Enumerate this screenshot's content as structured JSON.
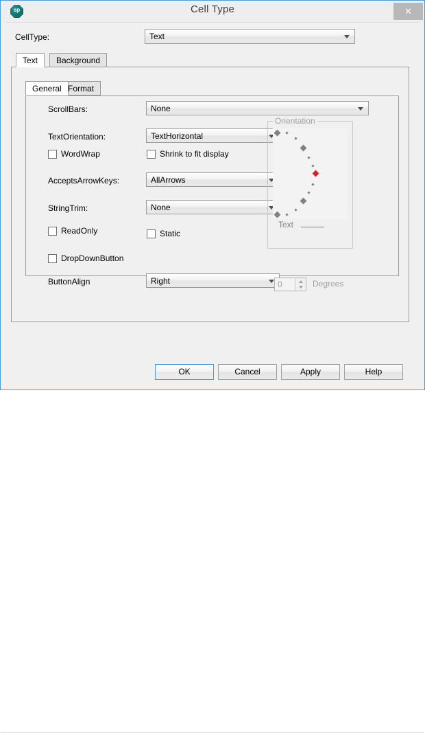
{
  "window": {
    "title": "Cell Type",
    "app_icon": "spreadsheet-octagon-icon",
    "app_icon_text": "sp",
    "close_label": "✕"
  },
  "celltype": {
    "label": "CellType:",
    "value": "Text"
  },
  "outer_tabs": [
    {
      "label": "Text",
      "active": true
    },
    {
      "label": "Background",
      "active": false
    }
  ],
  "inner_tabs": [
    {
      "label": "General",
      "active": true
    },
    {
      "label": "Format",
      "active": false
    }
  ],
  "form": {
    "scrollbars": {
      "label": "ScrollBars:",
      "value": "None"
    },
    "text_orientation": {
      "label": "TextOrientation:",
      "value": "TextHorizontal"
    },
    "word_wrap": {
      "label": "WordWrap",
      "checked": false
    },
    "shrink_to_fit": {
      "label": "Shrink to fit display",
      "checked": false
    },
    "accepts_arrow_keys": {
      "label": "AcceptsArrowKeys:",
      "value": "AllArrows"
    },
    "string_trim": {
      "label": "StringTrim:",
      "value": "None"
    },
    "read_only": {
      "label": "ReadOnly",
      "checked": false
    },
    "static": {
      "label": "Static",
      "checked": false
    },
    "dropdown_button": {
      "label": "DropDownButton",
      "checked": false
    },
    "button_align": {
      "label": "ButtonAlign",
      "value": "Right"
    }
  },
  "orientation": {
    "legend": "Orientation",
    "sample_text": "Text",
    "degrees_value": "0",
    "degrees_label": "Degrees",
    "enabled": false,
    "selected_color": "#d82020",
    "dot_color": "#808080"
  },
  "footer": {
    "ok": "OK",
    "cancel": "Cancel",
    "apply": "Apply",
    "help": "Help"
  },
  "colors": {
    "window_border": "#4a9bd8",
    "dialog_bg": "#f0f0f0",
    "titlebar_bg": "#eeeeee",
    "close_bg": "#b8b8b8",
    "disabled_text": "#a0a0a0"
  }
}
